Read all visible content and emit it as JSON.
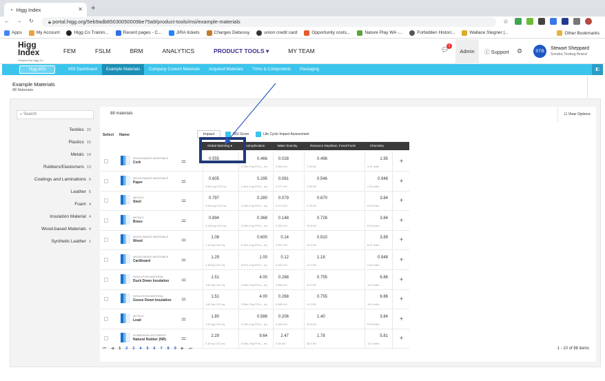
{
  "browser": {
    "tab_title": "Higg Index",
    "url": "portal.higg.org/5eb9adb85030050009be75a9/product-tools/msi/example-materials",
    "bookmarks": [
      "Apps",
      "My Account",
      "Higg Co Trainin...",
      "Recent pages - C...",
      "JIRA tickets",
      "Charges Debussy",
      "union credit card",
      "Opportunity costs...",
      "Nature Play WA -...",
      "Forbidden Histori...",
      "Wallace Stegner |..."
    ],
    "other_bookmarks": "Other Bookmarks"
  },
  "header": {
    "logo_line1": "Higg",
    "logo_line2": "Index",
    "logo_sub": "Powered by Higg Co",
    "nav": [
      "FEM",
      "FSLM",
      "BRM",
      "ANALYTICS",
      "PRODUCT TOOLS ▾",
      "MY TEAM"
    ],
    "notif_count": "1",
    "admin": "Admin",
    "support": "Support",
    "avatar_initials": "STB",
    "user_name": "Stewart Sheppard",
    "user_org": "Sondra Testing Brand"
  },
  "subnav": {
    "pill": "Higg MSI",
    "items": [
      "MSI Dashboard",
      "Example Materials",
      "Company Custom Materials",
      "Acquired Materials",
      "Trims & Components",
      "Packaging"
    ]
  },
  "page": {
    "title": "Example Materials",
    "subtitle": "88 Materials"
  },
  "sidebar": {
    "search_placeholder": "Search",
    "categories": [
      {
        "label": "Textiles",
        "count": "22"
      },
      {
        "label": "Plastics",
        "count": "15"
      },
      {
        "label": "Metals",
        "count": "14"
      },
      {
        "label": "Rubbers/Elastomers",
        "count": "13"
      },
      {
        "label": "Coatings and Laminations",
        "count": "6"
      },
      {
        "label": "Leather",
        "count": "5"
      },
      {
        "label": "Foam",
        "count": "4"
      },
      {
        "label": "Insulation Material",
        "count": "4"
      },
      {
        "label": "Wood-based Materials",
        "count": "4"
      },
      {
        "label": "Synthetic Leather",
        "count": "1"
      }
    ]
  },
  "table": {
    "count": "88 materials",
    "view_options": "View Options",
    "select": "Select",
    "name": "Name",
    "impact_tab": "Impact",
    "msi_score": "MSI Score",
    "lcia": "Life Cycle Impact Assessment",
    "columns": [
      "Global Warming",
      "Eutrophication",
      "Water Scarcity",
      "Resource Depletion, Fossil Fuels",
      "Chemistry"
    ],
    "rows": [
      {
        "cat": "Wood-based Materials",
        "name": "Cork",
        "v": [
          "0.555",
          "0.466",
          "0.028",
          "0.496",
          "1.95"
        ],
        "u": [
          "",
          "2.48e-4 kg PO4--- eq",
          "0.060 m3",
          "7.24 MJ",
          "4.11 units"
        ]
      },
      {
        "cat": "Wood-based Materials",
        "name": "Paper",
        "v": [
          "0.605",
          "0.295",
          "0.081",
          "0.546",
          "0.948"
        ],
        "u": [
          "0.641 kg CO2 eq",
          "2.61e-4 kg PO4--- eq",
          "0.177 m3",
          "7.96 MJ",
          "2.00 units"
        ]
      },
      {
        "cat": "Metals",
        "name": "Steel",
        "v": [
          "0.797",
          "0.280",
          "0.079",
          "0.670",
          "3.84"
        ],
        "u": [
          "0.844 kg CO2 eq",
          "2.48e-4 kg PO4--- eq",
          "0.173 m3",
          "9.78 MJ",
          "8.09 units"
        ]
      },
      {
        "cat": "Metals",
        "name": "Brass",
        "v": [
          "0.894",
          "0.368",
          "0.148",
          "0.726",
          "3.84"
        ],
        "u": [
          "0.946 kg CO2 eq",
          "3.26e-4 kg PO4--- eq",
          "0.323 m3",
          "10.6 MJ",
          "8.09 units"
        ]
      },
      {
        "cat": "Wood-based Materials",
        "name": "Wood",
        "v": [
          "1.08",
          "0.600",
          "0.14",
          "0.910",
          "3.89"
        ],
        "u": [
          "1.15 kg CO2 eq",
          "5.32e-4 kg PO4--- eq",
          "0.307 m3",
          "13.3 MJ",
          "8.21 units"
        ]
      },
      {
        "cat": "Wood-based Materials",
        "name": "Cardboard",
        "v": [
          "1.29",
          "1.00",
          "0.12",
          "1.18",
          "0.948"
        ],
        "u": [
          "1.36 kg CO2 eq",
          "8.87e-4 kg PO4--- eq",
          "0.261 m3",
          "17.2 MJ",
          "2.00 units"
        ]
      },
      {
        "cat": "Insulation Material",
        "name": "Duck Down Insulation",
        "v": [
          "1.51",
          "4.00",
          "0.268",
          "0.755",
          "6.86"
        ],
        "u": [
          "1.61 kg CO2 eq",
          "3.56e-3 kg PO4--- eq",
          "0.585 m3",
          "11.0 MJ",
          "14.5 units"
        ]
      },
      {
        "cat": "Insulation Material",
        "name": "Goose Down Insulation",
        "v": [
          "1.51",
          "4.00",
          "0.268",
          "0.755",
          "6.86"
        ],
        "u": [
          "1.61 kg CO2 eq",
          "3.56e-3 kg PO4--- eq",
          "0.585 m3",
          "11.0 MJ",
          "14.5 units"
        ]
      },
      {
        "cat": "Metals",
        "name": "Lead",
        "v": [
          "1.80",
          "0.586",
          "0.206",
          "1.40",
          "3.84"
        ],
        "u": [
          "1.91 kg CO2 eq",
          "5.20e-4 kg PO4--- eq",
          "0.450 m3",
          "20.5 MJ",
          "8.09 units"
        ]
      },
      {
        "cat": "Rubbers/Elastomers",
        "name": "Natural Rubber (NR)",
        "v": [
          "2.29",
          "9.64",
          "2.47",
          "1.78",
          "5.81"
        ],
        "u": [
          "2.43 kg CO2 eq",
          "8.56e-3 kg PO4--- eq",
          "5.38 m3",
          "26.0 MJ",
          "12.3 units"
        ]
      }
    ],
    "pager": [
      "⏮",
      "◀",
      "1",
      "2",
      "3",
      "4",
      "5",
      "6",
      "7",
      "8",
      "9",
      "▶",
      "⏭"
    ],
    "items_label": "1 - 10 of 88 items"
  }
}
